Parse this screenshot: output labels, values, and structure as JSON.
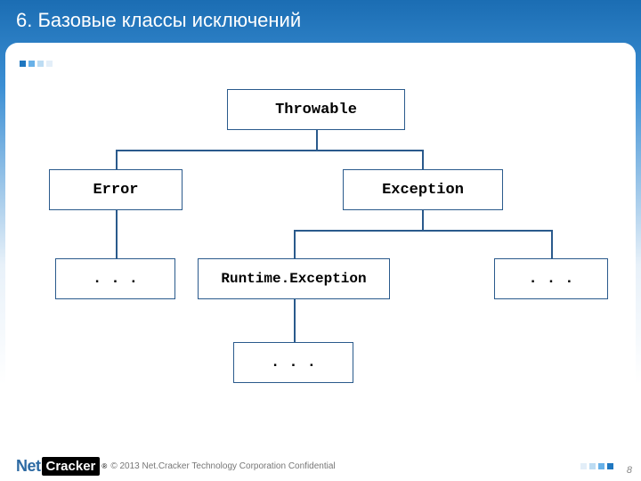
{
  "slide": {
    "title": "6. Базовые классы исключений",
    "page_number": "8"
  },
  "diagram": {
    "nodes": {
      "throwable": "Throwable",
      "error": "Error",
      "exception": "Exception",
      "error_child": ". . .",
      "runtime": "Runtime.Exception",
      "exception_other": ". . .",
      "runtime_child": ". . ."
    }
  },
  "footer": {
    "logo_net": "Net",
    "logo_cracker": "Cracker",
    "logo_reg": "®",
    "copyright": "© 2013 Net.Cracker Technology Corporation Confidential"
  }
}
